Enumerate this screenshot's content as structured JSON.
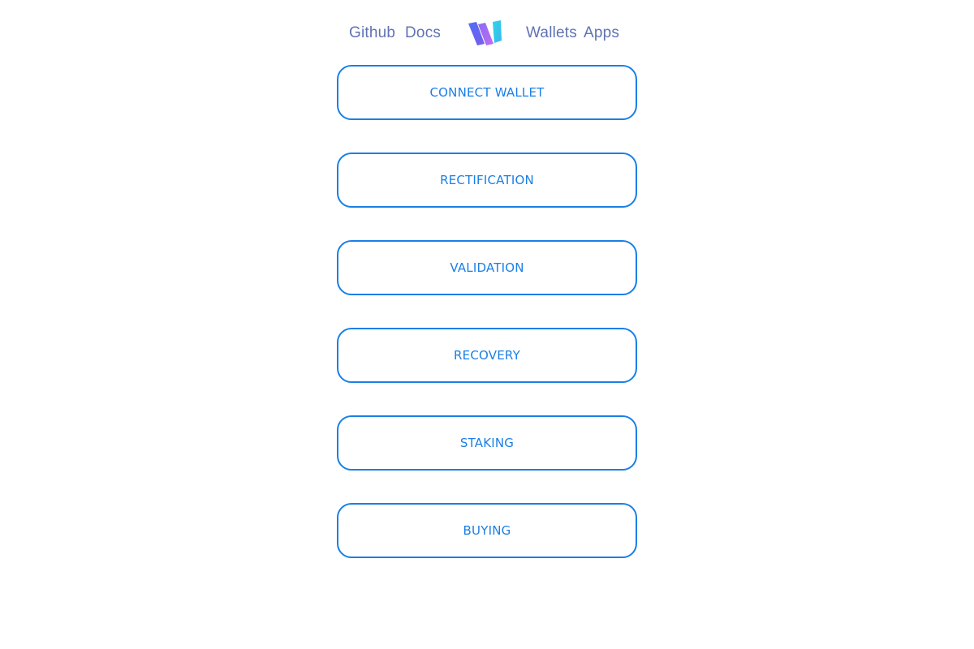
{
  "header": {
    "nav_left": [
      {
        "label": "Github"
      },
      {
        "label": "Docs"
      }
    ],
    "nav_right": [
      {
        "label": "Wallets"
      },
      {
        "label": "Apps"
      }
    ],
    "logo_icon": "walletconnect-w-logo-icon",
    "link_color": "#5f73b3"
  },
  "actions": [
    {
      "label": "CONNECT WALLET"
    },
    {
      "label": "RECTIFICATION"
    },
    {
      "label": "VALIDATION"
    },
    {
      "label": "RECOVERY"
    },
    {
      "label": "STAKING"
    },
    {
      "label": "BUYING"
    }
  ],
  "colors": {
    "accent": "#1a7fe6",
    "background": "#ffffff"
  }
}
